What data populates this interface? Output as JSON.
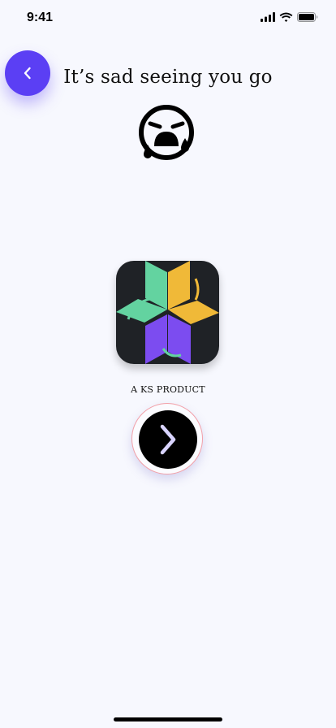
{
  "status_bar": {
    "time": "9:41"
  },
  "header": {
    "title": "It’s sad seeing you go"
  },
  "brand": {
    "tagline": "A KS PRODUCT"
  },
  "icons": {
    "back": "chevron-left-icon",
    "face": "crying-face-icon",
    "next": "chevron-right-icon",
    "signal": "signal-icon",
    "wifi": "wifi-icon",
    "battery": "battery-icon"
  },
  "colors": {
    "background": "#f7f8fe",
    "back_button": "#5b3ff4",
    "logo_green": "#63d3a0",
    "logo_yellow": "#f0b938",
    "logo_purple": "#7c4cf0",
    "next_button": "#000000",
    "next_chevron": "#d9d4ff"
  }
}
